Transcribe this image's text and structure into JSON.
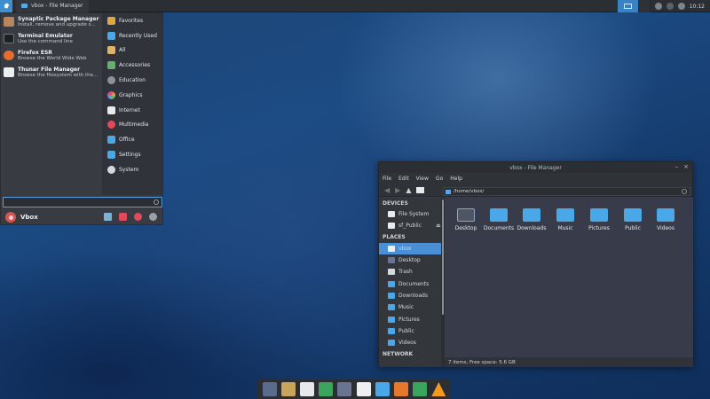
{
  "top_panel": {
    "task_title": "vbox - File Manager",
    "clock": "10:12"
  },
  "whisker_menu": {
    "favorites": [
      {
        "title": "Synaptic Package Manager",
        "desc": "Install, remove and upgrade s...",
        "color": "#b8865a"
      },
      {
        "title": "Terminal Emulator",
        "desc": "Use the command line",
        "color": "#1e2124"
      },
      {
        "title": "Firefox ESR",
        "desc": "Browse the World Wide Web",
        "color": "#e66b2c"
      },
      {
        "title": "Thunar File Manager",
        "desc": "Browse the filesystem with the...",
        "color": "#eceff2"
      }
    ],
    "categories": [
      {
        "label": "Favorites",
        "color": "#e0a640"
      },
      {
        "label": "Recently Used",
        "color": "#4aa8e8"
      },
      {
        "label": "All",
        "color": "#e0b468"
      },
      {
        "label": "Accessories",
        "color": "#5fb46a"
      },
      {
        "label": "Education",
        "color": "#8b9299"
      },
      {
        "label": "Graphics",
        "color": "#d650a2"
      },
      {
        "label": "Internet",
        "color": "#e8eaec"
      },
      {
        "label": "Multimedia",
        "color": "#e2495a"
      },
      {
        "label": "Office",
        "color": "#4aa8e8"
      },
      {
        "label": "Settings",
        "color": "#4aa8e8"
      },
      {
        "label": "System",
        "color": "#d6d9dc"
      }
    ],
    "search_value": "",
    "user_name": "Vbox"
  },
  "file_manager": {
    "title": "vbox - File Manager",
    "menu": [
      "File",
      "Edit",
      "View",
      "Go",
      "Help"
    ],
    "location": "/home/vbox/",
    "sidebar": {
      "devices_header": "DEVICES",
      "devices": [
        {
          "label": "File System",
          "color": "#e8eaec"
        },
        {
          "label": "sf_Public",
          "color": "#e8eaec"
        }
      ],
      "places_header": "PLACES",
      "places": [
        {
          "label": "vbox",
          "color": "#eceff2"
        },
        {
          "label": "Desktop",
          "color": "#6a7391"
        },
        {
          "label": "Trash",
          "color": "#d6d9dc"
        },
        {
          "label": "Documents",
          "color": "#4aa8e8"
        },
        {
          "label": "Downloads",
          "color": "#4aa8e8"
        },
        {
          "label": "Music",
          "color": "#4aa8e8"
        },
        {
          "label": "Pictures",
          "color": "#4aa8e8"
        },
        {
          "label": "Public",
          "color": "#4aa8e8"
        },
        {
          "label": "Videos",
          "color": "#4aa8e8"
        }
      ],
      "network_header": "NETWORK"
    },
    "items": [
      "Desktop",
      "Documents",
      "Downloads",
      "Music",
      "Pictures",
      "Public",
      "Videos"
    ],
    "status": "7 items, Free space: 5.6 GB"
  },
  "dock": {
    "items": [
      {
        "name": "desktop-icon",
        "color": "#5a6b8c"
      },
      {
        "name": "file-manager-icon",
        "color": "#c9a45c"
      },
      {
        "name": "mail-icon",
        "color": "#e6e8ea"
      },
      {
        "name": "software-store-icon",
        "color": "#3aa35c"
      },
      {
        "name": "screenshot-icon",
        "color": "#6a7391"
      },
      {
        "name": "document-viewer-icon",
        "color": "#f0f0f0"
      },
      {
        "name": "writer-icon",
        "color": "#4aa8e8"
      },
      {
        "name": "impress-icon",
        "color": "#e8772e"
      },
      {
        "name": "calc-icon",
        "color": "#3aa35c"
      },
      {
        "name": "vlc-icon",
        "color": "#f39a1e"
      }
    ]
  }
}
